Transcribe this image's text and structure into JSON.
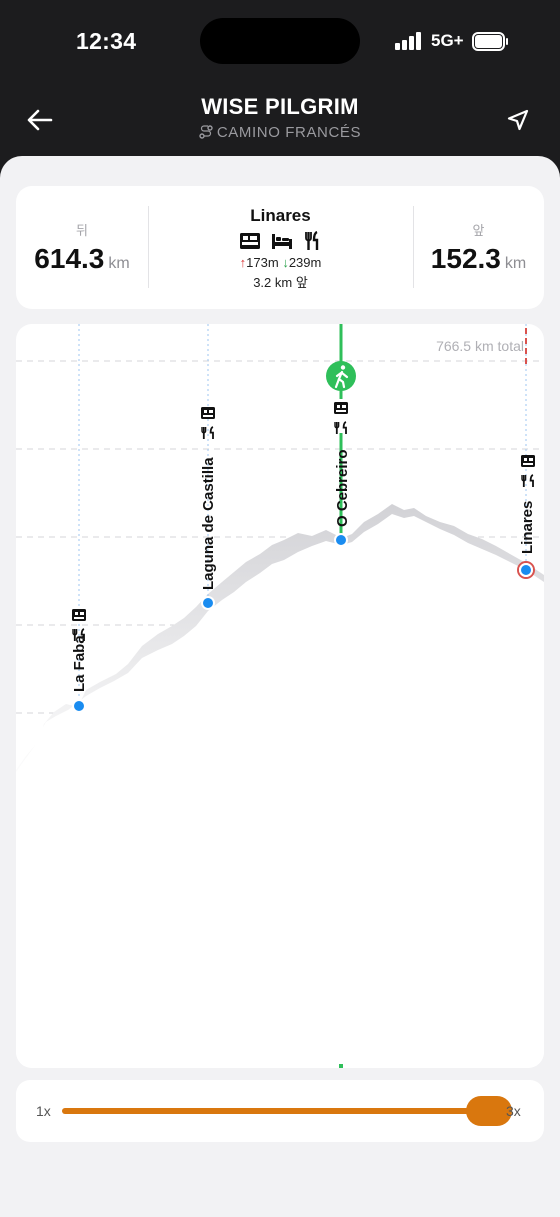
{
  "status_bar": {
    "time": "12:34",
    "network": "5G+"
  },
  "header": {
    "title": "WISE PILGRIM",
    "subtitle": "CAMINO FRANCÉS"
  },
  "summary": {
    "behind": {
      "label": "뒤",
      "value": "614.3",
      "unit": "km"
    },
    "ahead": {
      "label": "앞",
      "value": "152.3",
      "unit": "km"
    },
    "destination": {
      "name": "Linares",
      "amenity_icons": [
        "hostel-icon",
        "bed-icon",
        "restaurant-icon"
      ],
      "ascent": "173m",
      "descent": "239m",
      "distance_ahead": "3.2 km 앞"
    }
  },
  "profile": {
    "total_label": "766.5 km total",
    "current_position_icon": "walking-person-icon",
    "waypoints": [
      {
        "name": "La Faba",
        "icons": [
          "hostel-icon",
          "restaurant-icon"
        ]
      },
      {
        "name": "Laguna de Castilla",
        "icons": [
          "hostel-icon",
          "restaurant-icon"
        ]
      },
      {
        "name": "O Cebreiro",
        "icons": [
          "hostel-icon",
          "restaurant-icon"
        ],
        "current": true
      },
      {
        "name": "Linares",
        "icons": [
          "hostel-icon",
          "restaurant-icon"
        ],
        "destination": true
      }
    ],
    "colors": {
      "current": "#2fbf5a",
      "waypoint": "#1a8cf0",
      "terrain": "#dcdcdf",
      "end_marker": "#d9534f"
    }
  },
  "zoom": {
    "min_label": "1x",
    "max_label": "3x",
    "level": 1.0,
    "color": "#d9770e"
  }
}
